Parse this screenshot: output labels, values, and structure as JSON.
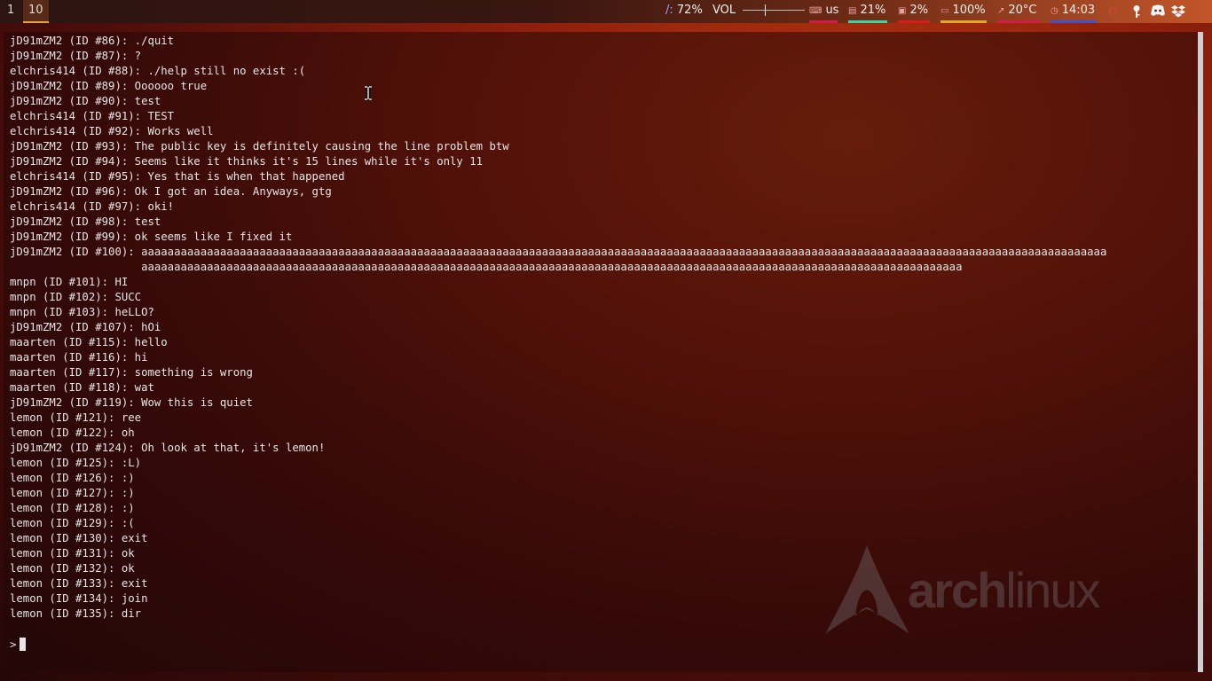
{
  "bar": {
    "workspaces": [
      "1",
      "10"
    ],
    "disk": {
      "label": "/:",
      "value": "72%"
    },
    "volume": {
      "label": "VOL",
      "level": 0.35
    },
    "keyboard": {
      "icon": "keyboard-icon",
      "value": "us"
    },
    "memory": {
      "icon": "memory-icon",
      "value": "21%",
      "color": "#37d6a6"
    },
    "cpu": {
      "icon": "cpu-icon",
      "value": "2%",
      "color": "#d81b1b"
    },
    "battery": {
      "icon": "battery-icon",
      "value": "100%",
      "color": "#e5a624"
    },
    "temperature": {
      "icon": "thermometer-icon",
      "value": "20°C",
      "color": "#d41a4a"
    },
    "clock": {
      "icon": "clock-icon",
      "value": "14:03",
      "color": "#3b52d6"
    },
    "keyboard_color": "#d41a4a",
    "tray": [
      "power-icon",
      "keepass-icon",
      "discord-icon",
      "dropbox-icon"
    ]
  },
  "terminal": {
    "lines": [
      "jD91mZM2 (ID #86): ./quit",
      "jD91mZM2 (ID #87): ?",
      "elchris414 (ID #88): ./help still no exist :(",
      "jD91mZM2 (ID #89): Oooooo true",
      "jD91mZM2 (ID #90): test",
      "elchris414 (ID #91): TEST",
      "elchris414 (ID #92): Works well",
      "jD91mZM2 (ID #93): The public key is definitely causing the line problem btw",
      "jD91mZM2 (ID #94): Seems like it thinks it's 15 lines while it's only 11",
      "elchris414 (ID #95): Yes that is when that happened",
      "jD91mZM2 (ID #96): Ok I got an idea. Anyways, gtg",
      "elchris414 (ID #97): oki!",
      "jD91mZM2 (ID #98): test",
      "jD91mZM2 (ID #99): ok seems like I fixed it",
      "jD91mZM2 (ID #100): aaaaaaaaaaaaaaaaaaaaaaaaaaaaaaaaaaaaaaaaaaaaaaaaaaaaaaaaaaaaaaaaaaaaaaaaaaaaaaaaaaaaaaaaaaaaaaaaaaaaaaaaaaaaaaaaaaaaaaaaaaaaaaaaaaaaaaaaaaaaaaaaaaa",
      "                    aaaaaaaaaaaaaaaaaaaaaaaaaaaaaaaaaaaaaaaaaaaaaaaaaaaaaaaaaaaaaaaaaaaaaaaaaaaaaaaaaaaaaaaaaaaaaaaaaaaaaaaaaaaaaaaaaaaaaaaaaaaaa",
      "mnpn (ID #101): HI",
      "mnpn (ID #102): SUCC",
      "mnpn (ID #103): heLLO?",
      "jD91mZM2 (ID #107): hOi",
      "maarten (ID #115): hello",
      "maarten (ID #116): hi",
      "maarten (ID #117): something is wrong",
      "maarten (ID #118): wat",
      "jD91mZM2 (ID #119): Wow this is quiet",
      "lemon (ID #121): ree",
      "lemon (ID #122): oh",
      "jD91mZM2 (ID #124): Oh look at that, it's lemon!",
      "lemon (ID #125): :L)",
      "lemon (ID #126): :)",
      "lemon (ID #127): :)",
      "lemon (ID #128): :)",
      "lemon (ID #129): :(",
      "lemon (ID #130): exit",
      "lemon (ID #131): ok",
      "lemon (ID #132): ok",
      "lemon (ID #133): exit",
      "lemon (ID #134): join",
      "lemon (ID #135): dir"
    ],
    "prompt": ">"
  },
  "wallpaper": {
    "logo_bold": "arch",
    "logo_light": "linux"
  }
}
